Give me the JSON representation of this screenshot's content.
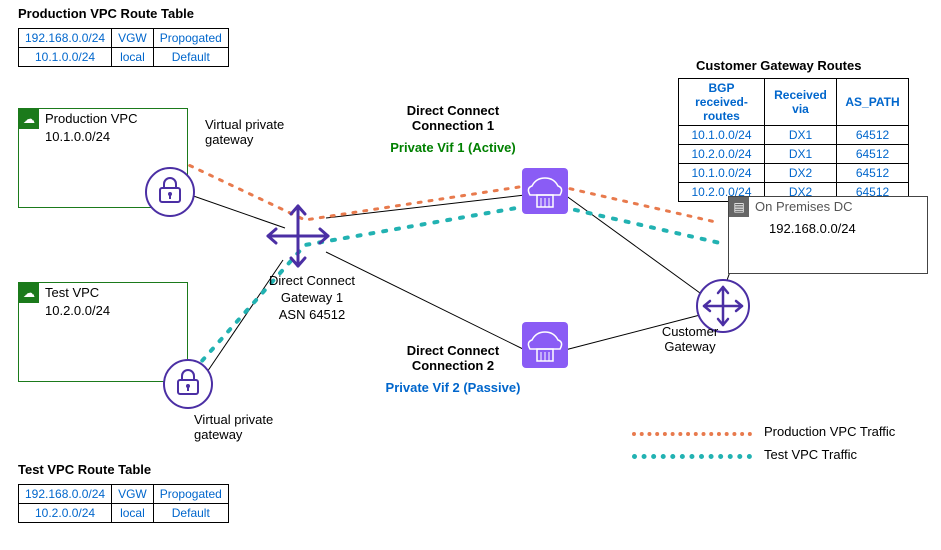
{
  "prod_route_table": {
    "title": "Production VPC Route Table",
    "rows": [
      {
        "c0": "192.168.0.0/24",
        "c1": "VGW",
        "c2": "Propogated"
      },
      {
        "c0": "10.1.0.0/24",
        "c1": "local",
        "c2": "Default"
      }
    ]
  },
  "test_route_table": {
    "title": "Test VPC Route Table",
    "rows": [
      {
        "c0": "192.168.0.0/24",
        "c1": "VGW",
        "c2": "Propogated"
      },
      {
        "c0": "10.2.0.0/24",
        "c1": "local",
        "c2": "Default"
      }
    ]
  },
  "cgw_table": {
    "title": "Customer Gateway Routes",
    "headers": {
      "h0": "BGP received-routes",
      "h1": "Received via",
      "h2": "AS_PATH"
    },
    "rows": [
      {
        "c0": "10.1.0.0/24",
        "c1": "DX1",
        "c2": "64512"
      },
      {
        "c0": "10.2.0.0/24",
        "c1": "DX1",
        "c2": "64512"
      },
      {
        "c0": "10.1.0.0/24",
        "c1": "DX2",
        "c2": "64512"
      },
      {
        "c0": "10.2.0.0/24",
        "c1": "DX2",
        "c2": "64512"
      }
    ]
  },
  "prod_vpc": {
    "name": "Production VPC",
    "cidr": "10.1.0.0/24"
  },
  "test_vpc": {
    "name": "Test VPC",
    "cidr": "10.2.0.0/24"
  },
  "vgw_label": "Virtual private gateway",
  "dxgw": {
    "line1": "Direct Connect",
    "line2": "Gateway 1",
    "line3": "ASN 64512"
  },
  "dx1": {
    "name": "Direct Connect Connection 1",
    "vif": "Private Vif 1 (Active)"
  },
  "dx2": {
    "name": "Direct Connect Connection 2",
    "vif": "Private Vif 2 (Passive)"
  },
  "cgw_label": "Customer Gateway",
  "onprem": {
    "name": "On Premises DC",
    "cidr": "192.168.0.0/24"
  },
  "legend": {
    "prod": "Production VPC Traffic",
    "test": "Test VPC Traffic"
  }
}
